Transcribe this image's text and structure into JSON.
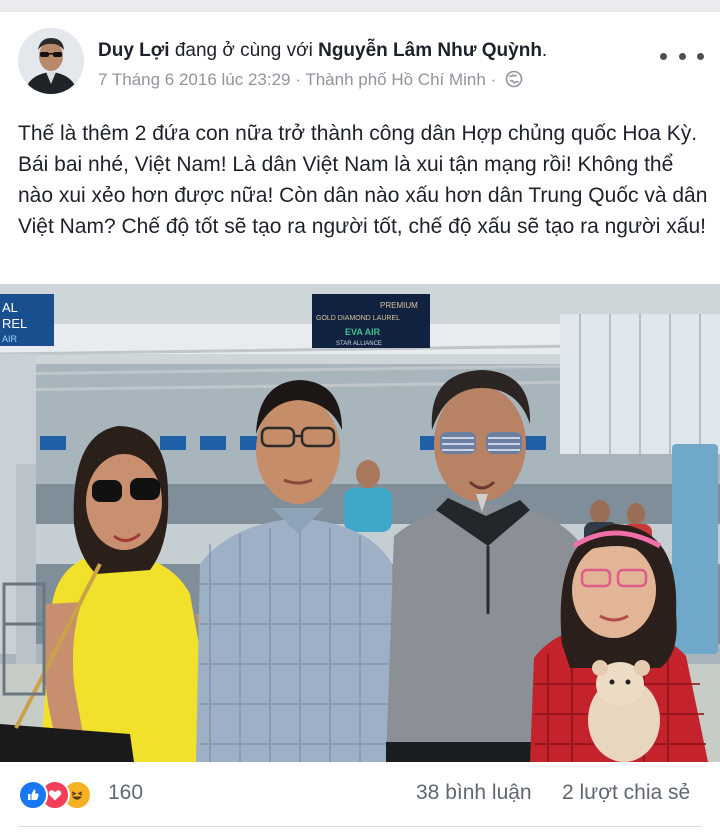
{
  "post": {
    "author": "Duy Lợi",
    "with_text": "đang ở cùng với",
    "tagged": "Nguyễn Lâm Như Quỳnh",
    "tagged_suffix": ".",
    "timestamp": "7 Tháng 6 2016 lúc 23:29",
    "separator": "·",
    "location": "Thành phố Hồ Chí Minh",
    "separator2": "·",
    "privacy_icon": "globe-icon",
    "body": "Thế là thêm 2 đứa con nữa trở thành công dân Hợp chủng quốc Hoa Kỳ. Bái bai nhé, Việt Nam! Là dân Việt Nam là xui tận mạng rồi! Không thể nào xui xẻo hơn được nữa! Còn dân nào xấu hơn dân Trung Quốc và dân Việt Nam? Chế độ tốt sẽ tạo ra người tốt, chế độ xấu sẽ tạo ra người xấu!"
  },
  "photo": {
    "signs": {
      "left_lines": [
        "AL",
        "REL",
        "AIR"
      ],
      "center_top": "PREMIUM",
      "center_mid": "GOLD DIAMOND  LAUREL",
      "center_brand": "EVA AIR",
      "center_sub": "STAR ALLIANCE"
    }
  },
  "footer": {
    "reactions": [
      "like-icon",
      "love-icon",
      "haha-icon"
    ],
    "reaction_count": "160",
    "comments": "38 bình luận",
    "shares": "2 lượt chia sẻ"
  },
  "colors": {
    "like": "#1877f2",
    "love": "#f33e58",
    "haha": "#f7b125",
    "text": "#1d2129",
    "meta": "#90949c"
  }
}
